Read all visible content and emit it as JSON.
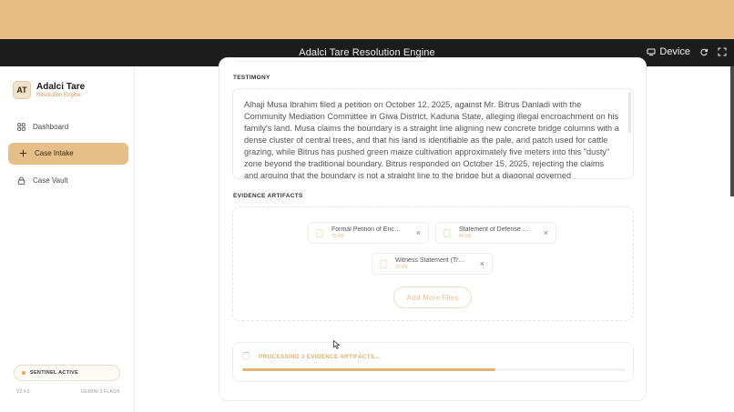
{
  "window": {
    "title": "Adalci Tare Resolution Engine",
    "device_label": "Device",
    "icons": [
      "device-icon",
      "refresh-icon",
      "fullscreen-icon"
    ]
  },
  "colors": {
    "accent": "#e6be88",
    "accent_text": "#c99a55",
    "titlebar": "#1c1c1c",
    "top_band": "#e8bd85"
  },
  "sidebar": {
    "avatar": "AT",
    "brand_name": "Adalci Tare",
    "brand_sub": "Resolution Engine",
    "items": [
      {
        "label": "Dashboard",
        "icon": "grid-icon",
        "active": false
      },
      {
        "label": "Case Intake",
        "icon": "plus-icon",
        "active": true
      },
      {
        "label": "Case Vault",
        "icon": "lock-icon",
        "active": false
      }
    ],
    "status": "SENTINEL ACTIVE",
    "version": "V2.4.0",
    "model": "GEMINI 3 FLASH"
  },
  "testimony": {
    "label": "TESTIMONY",
    "text": "Alhaji Musa Ibrahim filed a petition on October 12, 2025, against Mr. Bitrus Danladi with the Community Mediation Committee in Giwa District, Kaduna State, alleging illegal encroachment on his family's land. Musa claims the boundary is a straight line aligning new concrete bridge columns with a dense cluster of central trees, and that his land is identifiable as the pale, arid patch used for cattle grazing, while Bitrus has pushed green maize cultivation approximately five meters into this \"dusty\" zone beyond the traditional boundary. Bitrus responded on October 15, 2025, rejecting the claims and arguing that the boundary is not a straight line to the bridge but a diagonal governed"
  },
  "evidence": {
    "label": "EVIDENCE ARTIFACTS",
    "files": [
      {
        "name": "Formal Petition of Encroachment",
        "size": "75 KB"
      },
      {
        "name": "Statement of Defense and Counterclaim",
        "size": "80 KB"
      },
      {
        "name": "Witness Statement (Traditional)",
        "size": "70 KB"
      }
    ],
    "remove_glyph": "×",
    "add_more": "Add More Files"
  },
  "processing": {
    "text": "PROCESSING 3 EVIDENCE ARTIFACTS...",
    "progress": 0.66
  }
}
